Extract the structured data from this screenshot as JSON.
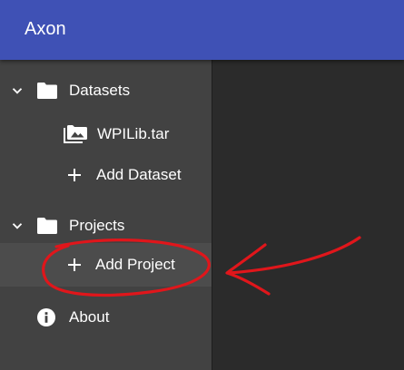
{
  "app": {
    "title": "Axon",
    "accent": "#3f51b5",
    "annotation_color": "#e0161b"
  },
  "sidebar": {
    "datasets": {
      "label": "Datasets",
      "icons": [
        "chevron-down-icon",
        "folder-icon"
      ],
      "items": [
        {
          "label": "WPILib.tar",
          "icon": "image-folder-icon"
        },
        {
          "label": "Add Dataset",
          "icon": "plus-icon"
        }
      ]
    },
    "projects": {
      "label": "Projects",
      "icons": [
        "chevron-down-icon",
        "folder-icon"
      ],
      "items": [
        {
          "label": "Add Project",
          "icon": "plus-icon"
        }
      ]
    },
    "about": {
      "label": "About",
      "icon": "info-icon"
    }
  }
}
